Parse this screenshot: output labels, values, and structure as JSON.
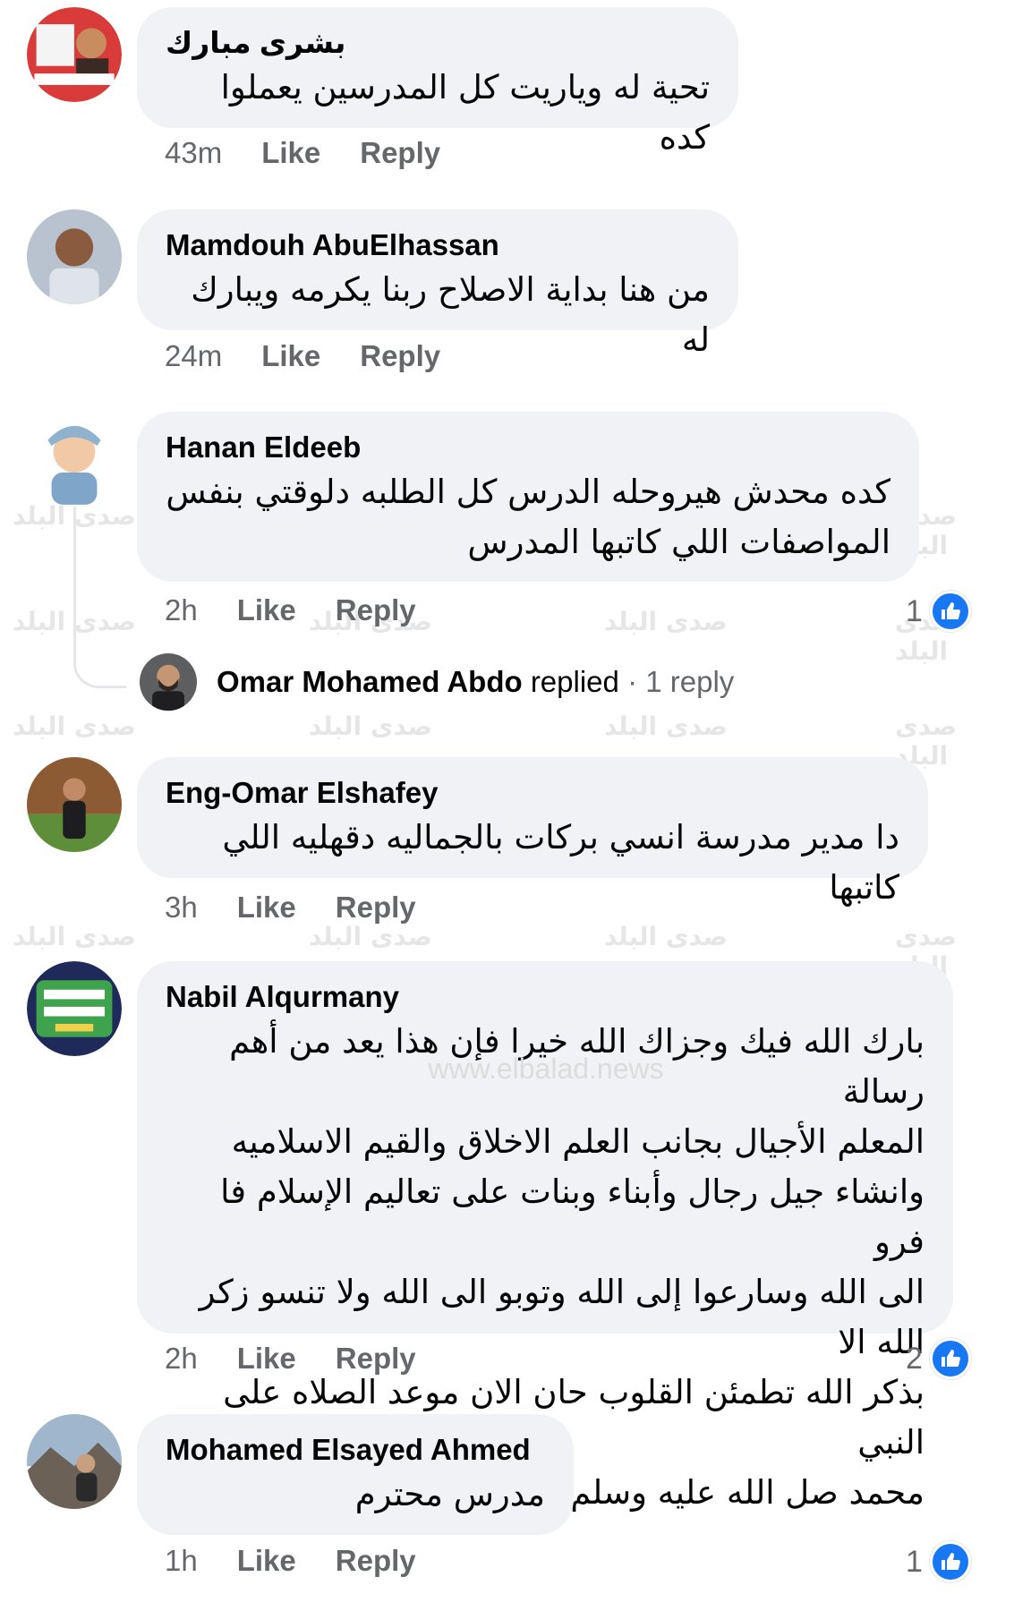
{
  "watermark": {
    "text": "صدى البلد",
    "url": "www.elbalad.news"
  },
  "comments": [
    {
      "author": "بشرى مبارك",
      "lines": [
        "تحية له وياريت كل المدرسين يعملوا كده"
      ],
      "time": "43m",
      "like": "Like",
      "reply": "Reply",
      "avatar": "profile-photo-badge"
    },
    {
      "author": "Mamdouh AbuElhassan",
      "lines": [
        "من هنا بداية الاصلاح ربنا يكرمه ويبارك له"
      ],
      "time": "24m",
      "like": "Like",
      "reply": "Reply",
      "avatar": "profile-photo-man"
    },
    {
      "author": "Hanan Eldeeb",
      "lines": [
        "كده محدش هيروحله الدرس   كل الطلبه دلوقتي بنفس",
        "المواصفات اللي كاتبها المدرس"
      ],
      "time": "2h",
      "like": "Like",
      "reply": "Reply",
      "reaction_count": "1",
      "avatar": "profile-photo-child"
    },
    {
      "author": "Eng-Omar Elshafey",
      "lines": [
        "دا مدير مدرسة انسي بركات بالجماليه دقهليه اللي كاتبها"
      ],
      "time": "3h",
      "like": "Like",
      "reply": "Reply",
      "avatar": "profile-photo-man-outdoor"
    },
    {
      "author": "Nabil Alqurmany",
      "lines": [
        "بارك الله فيك وجزاك الله خيرا فإن هذا يعد من أهم رسالة",
        "المعلم الأجيال بجانب العلم الاخلاق والقيم الاسلاميه",
        "وانشاء جيل رجال وأبناء وبنات على تعاليم الإسلام فا فرو",
        "الى الله وسارعوا إلى الله وتوبو الى الله ولا تنسو زكر الله الا",
        "بذكر الله تطمئن القلوب حان الان موعد الصلاه على النبي",
        "محمد صل الله عليه وسلم وعلى اله وصحبه اجمعين"
      ],
      "time": "2h",
      "like": "Like",
      "reply": "Reply",
      "reaction_count": "2",
      "avatar": "profile-photo-text-badge"
    },
    {
      "author": "Mohamed Elsayed Ahmed",
      "lines": [
        "مدرس محترم"
      ],
      "time": "1h",
      "like": "Like",
      "reply": "Reply",
      "reaction_count": "1",
      "avatar": "profile-photo-man-mountain"
    }
  ],
  "reply_thread": {
    "author": "Omar Mohamed Abdo",
    "verb": "replied",
    "separator": "·",
    "count_label": "1 reply"
  },
  "colors": {
    "bubble": "#f0f2f5",
    "secondary_text": "#65676b",
    "like_blue": "#1877f2"
  }
}
